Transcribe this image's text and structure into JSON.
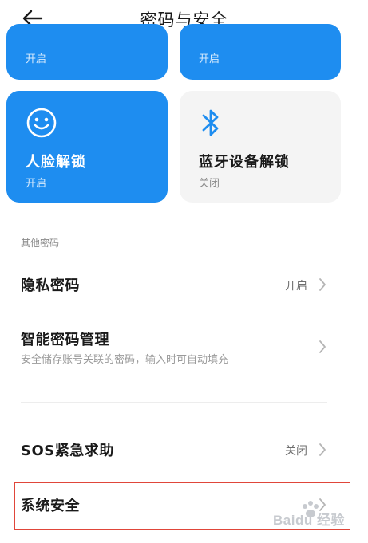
{
  "header": {
    "back_icon": "arrow-left-icon",
    "title": "密码与安全"
  },
  "tiles": {
    "top_left": {
      "status": "开启"
    },
    "top_right": {
      "status": "开启"
    },
    "face_unlock": {
      "icon": "smiley-icon",
      "title": "人脸解锁",
      "status": "开启"
    },
    "bluetooth_unlock": {
      "icon": "bluetooth-icon",
      "title": "蓝牙设备解锁",
      "status": "关闭"
    }
  },
  "section": {
    "other_passwords_label": "其他密码"
  },
  "rows": {
    "privacy_password": {
      "title": "隐私密码",
      "value": "开启"
    },
    "smart_password": {
      "title": "智能密码管理",
      "subtitle": "安全储存账号关联的密码，输入时可自动填充"
    },
    "sos": {
      "title": "SOS紧急求助",
      "value": "关闭"
    },
    "system_security": {
      "title": "系统安全"
    }
  },
  "watermark": {
    "text": "Baidu 经验"
  },
  "colors": {
    "accent_blue": "#1e8df0",
    "tile_grey": "#f4f4f4",
    "highlight_red": "#e0463a"
  }
}
